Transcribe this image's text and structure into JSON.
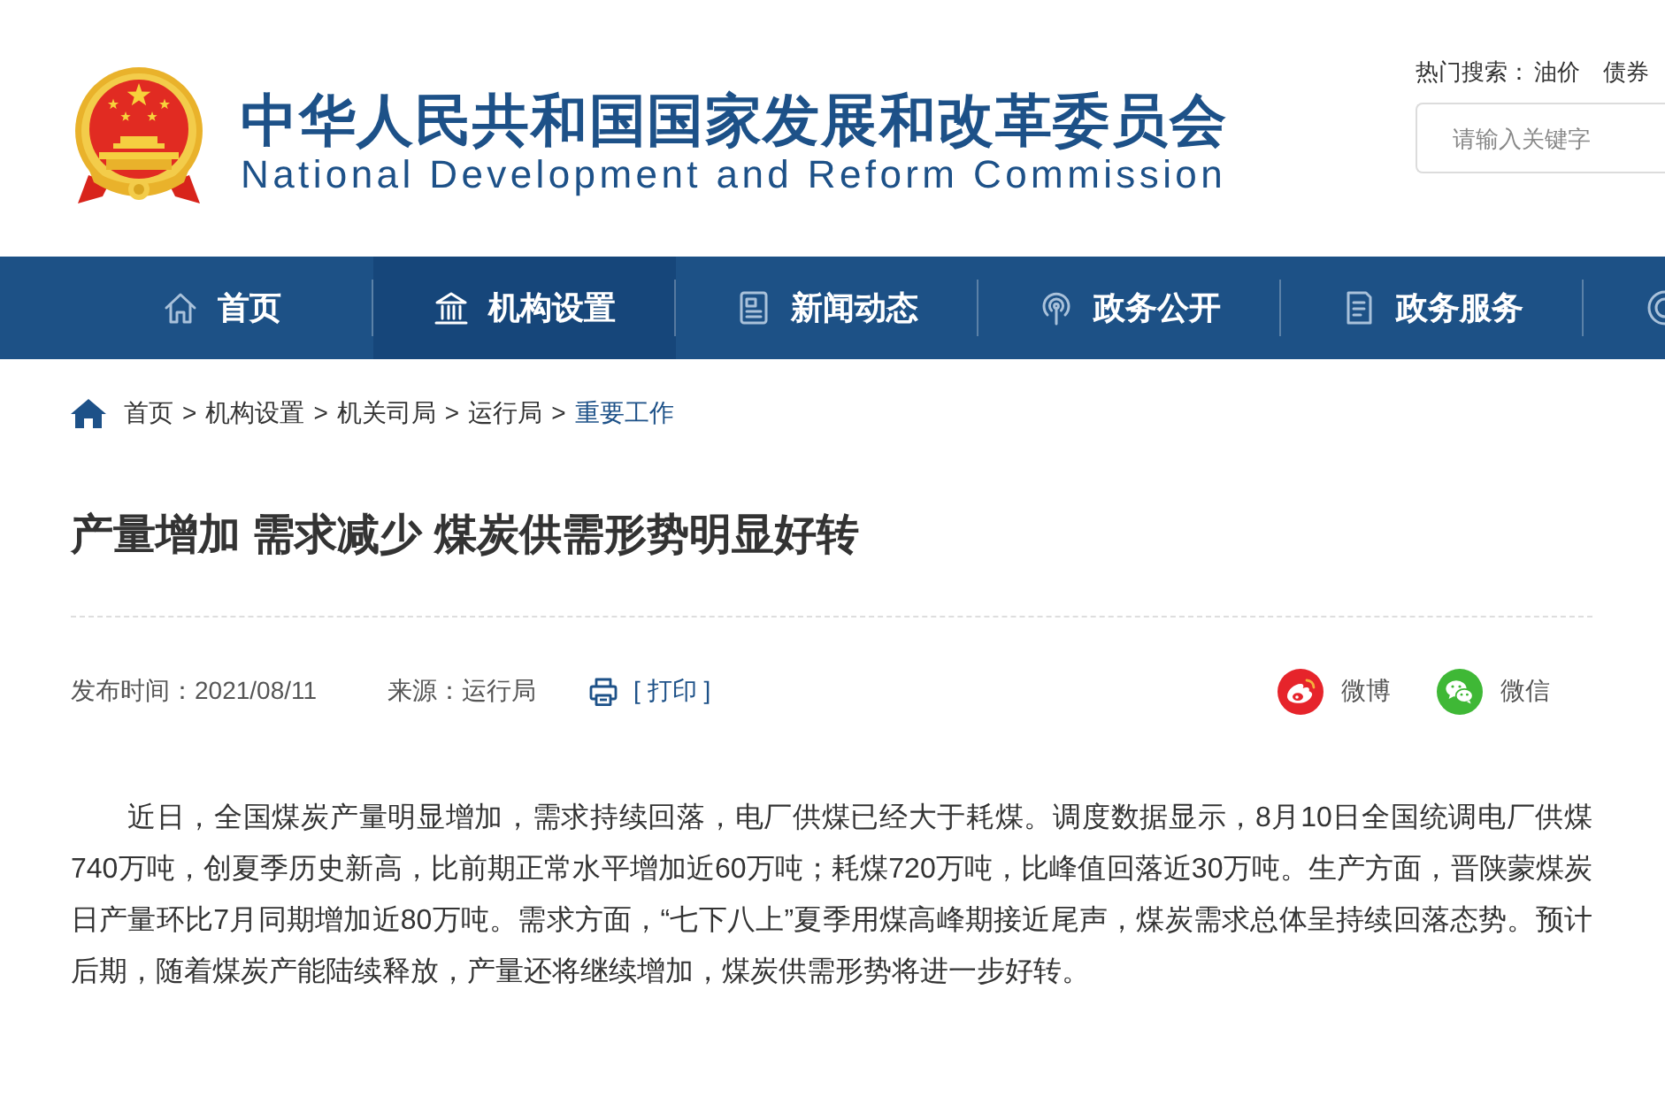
{
  "header": {
    "logo_title": "中华人民共和国国家发展和改革委员会",
    "logo_subtitle": "National Development and Reform Commission",
    "hot_search": {
      "label": "热门搜索：",
      "terms": [
        "油价",
        "债券"
      ]
    },
    "search": {
      "placeholder": "请输入关键字"
    }
  },
  "nav": {
    "items": [
      {
        "label": "首页",
        "selected": false
      },
      {
        "label": "机构设置",
        "selected": true
      },
      {
        "label": "新闻动态",
        "selected": false
      },
      {
        "label": "政务公开",
        "selected": false
      },
      {
        "label": "政务服务",
        "selected": false
      }
    ]
  },
  "breadcrumb": [
    {
      "kind": "link",
      "text": "首页",
      "current": false
    },
    {
      "kind": "separator",
      "text": ">"
    },
    {
      "kind": "link",
      "text": "机构设置",
      "current": false
    },
    {
      "kind": "separator",
      "text": ">"
    },
    {
      "kind": "link",
      "text": "机关司局",
      "current": false
    },
    {
      "kind": "separator",
      "text": ">"
    },
    {
      "kind": "link",
      "text": "运行局",
      "current": false
    },
    {
      "kind": "separator",
      "text": ">"
    },
    {
      "kind": "link",
      "text": "重要工作",
      "current": true
    }
  ],
  "article": {
    "title": "产量增加 需求减少 煤炭供需形势明显好转",
    "meta": {
      "published": "发布时间：2021/08/11",
      "source": "来源：运行局",
      "print": "[ 打印 ]"
    },
    "share": [
      {
        "kind": "weibo",
        "label": "微博"
      },
      {
        "kind": "wechat",
        "label": "微信"
      }
    ],
    "body": [
      "近日，全国煤炭产量明显增加，需求持续回落，电厂供煤已经大于耗煤。调度数据显示，8月10日全国统调电厂供煤740万吨，创夏季历史新高，比前期正常水平增加近60万吨；耗煤720万吨，比峰值回落近30万吨。生产方面，晋陕蒙煤炭日产量环比7月同期增加近80万吨。需求方面，“七下八上”夏季用煤高峰期接近尾声，煤炭需求总体呈持续回落态势。预计后期，随着煤炭产能陆续释放，产量还将继续增加，煤炭供需形势将进一步好转。"
    ]
  }
}
